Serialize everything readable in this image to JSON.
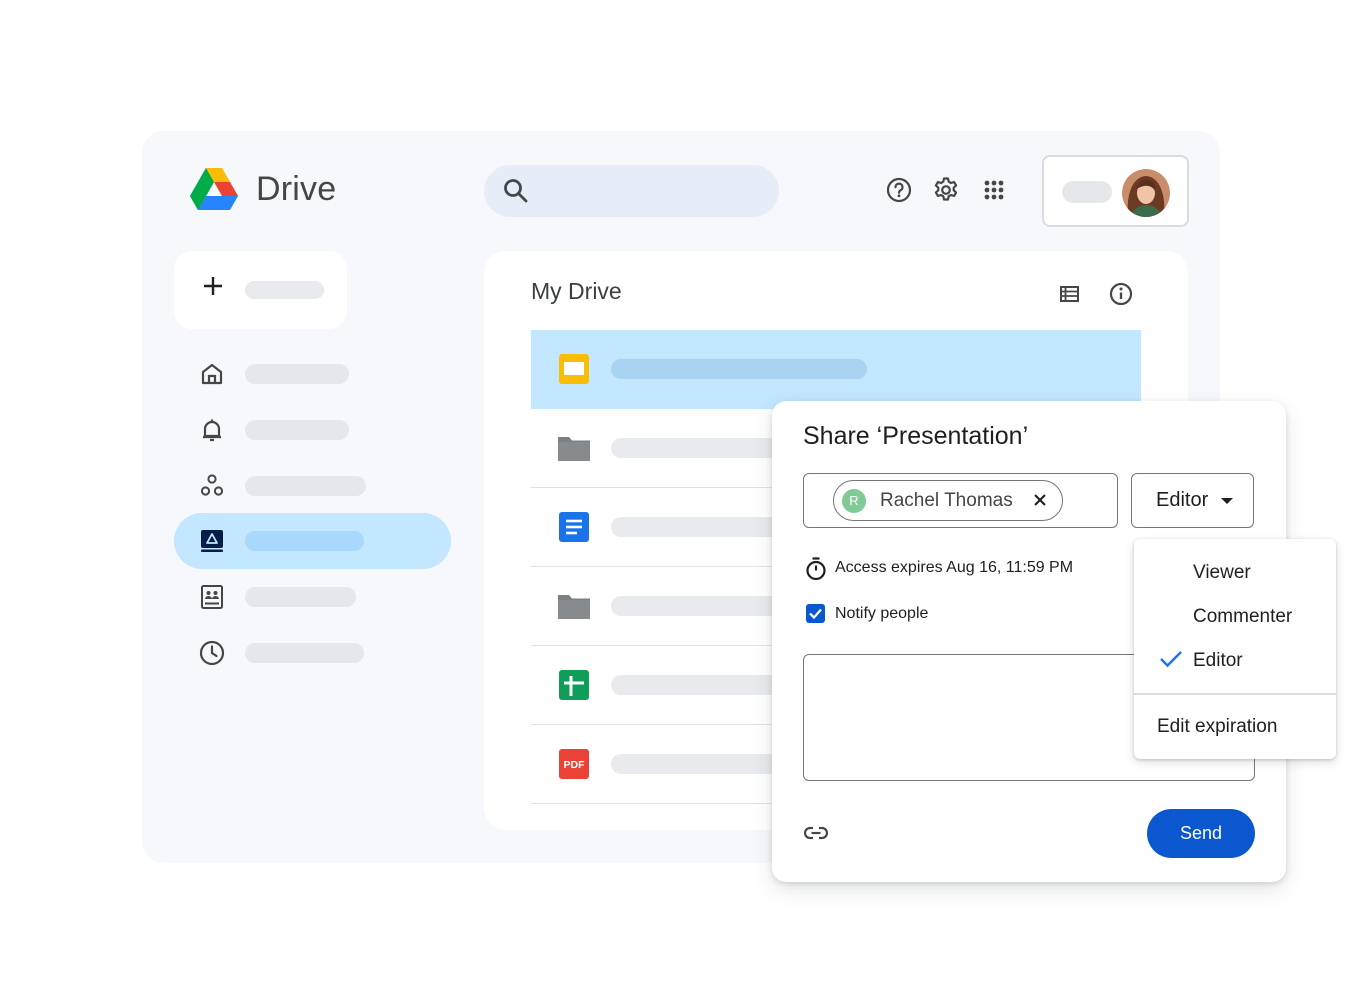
{
  "app": {
    "name": "Drive"
  },
  "main": {
    "title": "My Drive"
  },
  "files": [
    {
      "type": "slides",
      "selected": true
    },
    {
      "type": "folder"
    },
    {
      "type": "docs"
    },
    {
      "type": "folder"
    },
    {
      "type": "sheets"
    },
    {
      "type": "pdf",
      "badge": "PDF"
    }
  ],
  "share_dialog": {
    "title": "Share ‘Presentation’",
    "recipient": {
      "initial": "R",
      "name": "Rachel Thomas"
    },
    "role": "Editor",
    "access_expiry": "Access expires Aug 16, 11:59 PM",
    "notify_label": "Notify people",
    "notify_checked": true,
    "send_label": "Send"
  },
  "role_menu": {
    "items": [
      "Viewer",
      "Commenter",
      "Editor"
    ],
    "selected": "Editor",
    "edit_expiration": "Edit expiration"
  },
  "colors": {
    "accent": "#0b57d0",
    "selected_bg": "#c2e7ff",
    "app_bg": "#f6f8fc"
  }
}
